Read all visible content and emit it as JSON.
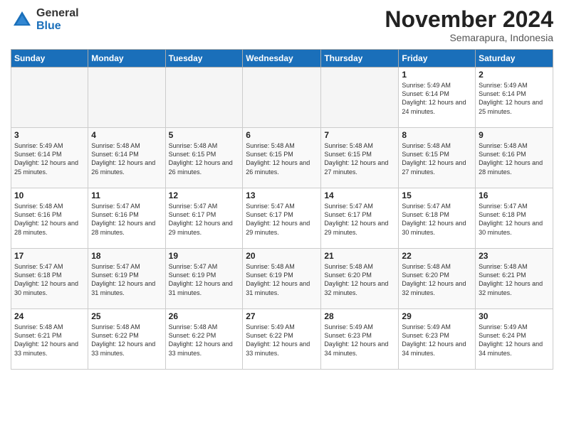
{
  "logo": {
    "general": "General",
    "blue": "Blue"
  },
  "header": {
    "month": "November 2024",
    "location": "Semarapura, Indonesia"
  },
  "days_of_week": [
    "Sunday",
    "Monday",
    "Tuesday",
    "Wednesday",
    "Thursday",
    "Friday",
    "Saturday"
  ],
  "weeks": [
    [
      {
        "day": "",
        "info": ""
      },
      {
        "day": "",
        "info": ""
      },
      {
        "day": "",
        "info": ""
      },
      {
        "day": "",
        "info": ""
      },
      {
        "day": "",
        "info": ""
      },
      {
        "day": "1",
        "info": "Sunrise: 5:49 AM\nSunset: 6:14 PM\nDaylight: 12 hours and 24 minutes."
      },
      {
        "day": "2",
        "info": "Sunrise: 5:49 AM\nSunset: 6:14 PM\nDaylight: 12 hours and 25 minutes."
      }
    ],
    [
      {
        "day": "3",
        "info": "Sunrise: 5:49 AM\nSunset: 6:14 PM\nDaylight: 12 hours and 25 minutes."
      },
      {
        "day": "4",
        "info": "Sunrise: 5:48 AM\nSunset: 6:14 PM\nDaylight: 12 hours and 26 minutes."
      },
      {
        "day": "5",
        "info": "Sunrise: 5:48 AM\nSunset: 6:15 PM\nDaylight: 12 hours and 26 minutes."
      },
      {
        "day": "6",
        "info": "Sunrise: 5:48 AM\nSunset: 6:15 PM\nDaylight: 12 hours and 26 minutes."
      },
      {
        "day": "7",
        "info": "Sunrise: 5:48 AM\nSunset: 6:15 PM\nDaylight: 12 hours and 27 minutes."
      },
      {
        "day": "8",
        "info": "Sunrise: 5:48 AM\nSunset: 6:15 PM\nDaylight: 12 hours and 27 minutes."
      },
      {
        "day": "9",
        "info": "Sunrise: 5:48 AM\nSunset: 6:16 PM\nDaylight: 12 hours and 28 minutes."
      }
    ],
    [
      {
        "day": "10",
        "info": "Sunrise: 5:48 AM\nSunset: 6:16 PM\nDaylight: 12 hours and 28 minutes."
      },
      {
        "day": "11",
        "info": "Sunrise: 5:47 AM\nSunset: 6:16 PM\nDaylight: 12 hours and 28 minutes."
      },
      {
        "day": "12",
        "info": "Sunrise: 5:47 AM\nSunset: 6:17 PM\nDaylight: 12 hours and 29 minutes."
      },
      {
        "day": "13",
        "info": "Sunrise: 5:47 AM\nSunset: 6:17 PM\nDaylight: 12 hours and 29 minutes."
      },
      {
        "day": "14",
        "info": "Sunrise: 5:47 AM\nSunset: 6:17 PM\nDaylight: 12 hours and 29 minutes."
      },
      {
        "day": "15",
        "info": "Sunrise: 5:47 AM\nSunset: 6:18 PM\nDaylight: 12 hours and 30 minutes."
      },
      {
        "day": "16",
        "info": "Sunrise: 5:47 AM\nSunset: 6:18 PM\nDaylight: 12 hours and 30 minutes."
      }
    ],
    [
      {
        "day": "17",
        "info": "Sunrise: 5:47 AM\nSunset: 6:18 PM\nDaylight: 12 hours and 30 minutes."
      },
      {
        "day": "18",
        "info": "Sunrise: 5:47 AM\nSunset: 6:19 PM\nDaylight: 12 hours and 31 minutes."
      },
      {
        "day": "19",
        "info": "Sunrise: 5:47 AM\nSunset: 6:19 PM\nDaylight: 12 hours and 31 minutes."
      },
      {
        "day": "20",
        "info": "Sunrise: 5:48 AM\nSunset: 6:19 PM\nDaylight: 12 hours and 31 minutes."
      },
      {
        "day": "21",
        "info": "Sunrise: 5:48 AM\nSunset: 6:20 PM\nDaylight: 12 hours and 32 minutes."
      },
      {
        "day": "22",
        "info": "Sunrise: 5:48 AM\nSunset: 6:20 PM\nDaylight: 12 hours and 32 minutes."
      },
      {
        "day": "23",
        "info": "Sunrise: 5:48 AM\nSunset: 6:21 PM\nDaylight: 12 hours and 32 minutes."
      }
    ],
    [
      {
        "day": "24",
        "info": "Sunrise: 5:48 AM\nSunset: 6:21 PM\nDaylight: 12 hours and 33 minutes."
      },
      {
        "day": "25",
        "info": "Sunrise: 5:48 AM\nSunset: 6:22 PM\nDaylight: 12 hours and 33 minutes."
      },
      {
        "day": "26",
        "info": "Sunrise: 5:48 AM\nSunset: 6:22 PM\nDaylight: 12 hours and 33 minutes."
      },
      {
        "day": "27",
        "info": "Sunrise: 5:49 AM\nSunset: 6:22 PM\nDaylight: 12 hours and 33 minutes."
      },
      {
        "day": "28",
        "info": "Sunrise: 5:49 AM\nSunset: 6:23 PM\nDaylight: 12 hours and 34 minutes."
      },
      {
        "day": "29",
        "info": "Sunrise: 5:49 AM\nSunset: 6:23 PM\nDaylight: 12 hours and 34 minutes."
      },
      {
        "day": "30",
        "info": "Sunrise: 5:49 AM\nSunset: 6:24 PM\nDaylight: 12 hours and 34 minutes."
      }
    ]
  ]
}
